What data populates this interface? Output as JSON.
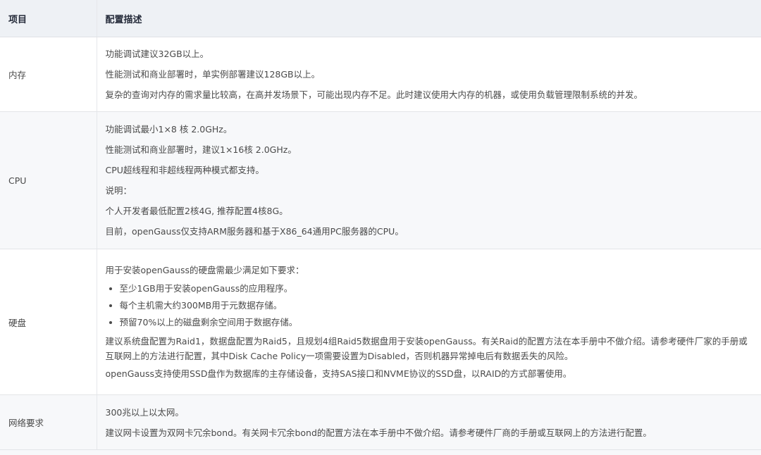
{
  "table": {
    "header": {
      "item": "项目",
      "desc": "配置描述"
    },
    "memory": {
      "item": "内存",
      "lines": [
        "功能调试建议32GB以上。",
        "性能测试和商业部署时，单实例部署建议128GB以上。",
        "复杂的查询对内存的需求量比较高，在高并发场景下，可能出现内存不足。此时建议使用大内存的机器，或使用负载管理限制系统的并发。"
      ]
    },
    "cpu": {
      "item": "CPU",
      "lines": [
        "功能调试最小1×8 核 2.0GHz。",
        "性能测试和商业部署时，建议1×16核 2.0GHz。",
        "CPU超线程和非超线程两种模式都支持。",
        "说明：",
        "个人开发者最低配置2核4G, 推荐配置4核8G。",
        "目前，openGauss仅支持ARM服务器和基于X86_64通用PC服务器的CPU。"
      ]
    },
    "disk": {
      "item": "硬盘",
      "intro": "用于安装openGauss的硬盘需最少满足如下要求：",
      "bullets": [
        "至少1GB用于安装openGauss的应用程序。",
        "每个主机需大约300MB用于元数据存储。",
        "预留70%以上的磁盘剩余空间用于数据存储。"
      ],
      "para1": "建议系统盘配置为Raid1，数据盘配置为Raid5，且规划4组Raid5数据盘用于安装openGauss。有关Raid的配置方法在本手册中不做介绍。请参考硬件厂家的手册或互联网上的方法进行配置，其中Disk Cache Policy一项需要设置为Disabled，否则机器异常掉电后有数据丢失的风险。",
      "para2": "openGauss支持使用SSD盘作为数据库的主存储设备，支持SAS接口和NVME协议的SSD盘，以RAID的方式部署使用。"
    },
    "network": {
      "item": "网络要求",
      "lines": [
        "300兆以上以太网。",
        "建议网卡设置为双网卡冗余bond。有关网卡冗余bond的配置方法在本手册中不做介绍。请参考硬件厂商的手册或互联网上的方法进行配置。"
      ]
    }
  }
}
